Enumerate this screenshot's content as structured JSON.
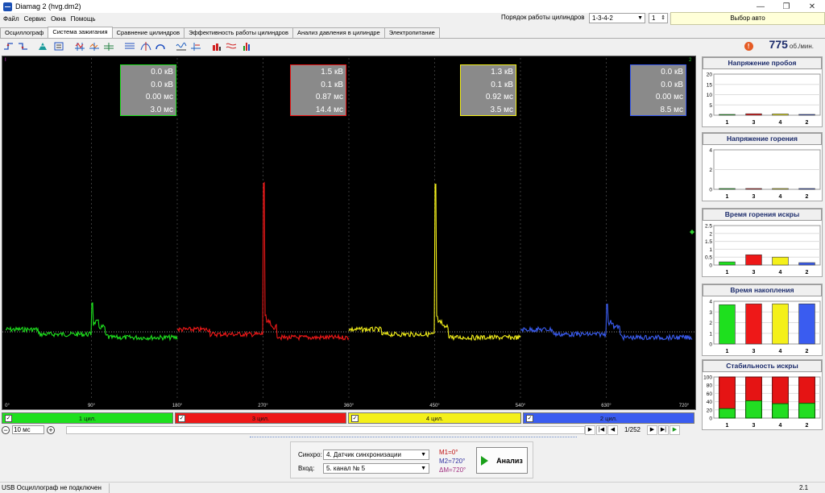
{
  "window": {
    "title": "Diamag 2 (hvg.dm2)",
    "min": "—",
    "restore": "❐",
    "close": "✕"
  },
  "menu": [
    "Файл",
    "Сервис",
    "Окна",
    "Помощь"
  ],
  "header": {
    "cyl_order_label": "Порядок работы цилиндров",
    "cyl_order_value": "1-3-4-2",
    "cyl_num_value": "1",
    "auto_label": "Выбор авто"
  },
  "tabs": [
    "Осциллограф",
    "Система зажигания",
    "Сравнение цилиндров",
    "Эффективность работы цилиндров",
    "Анализ давления в цилиндре",
    "Электропитание"
  ],
  "active_tab": 1,
  "rpm": {
    "warn": "!",
    "value": "775",
    "unit": "об./мин."
  },
  "cylinders": [
    {
      "label": "1 цил.",
      "color": "#1ee01e",
      "check": "✓",
      "box": [
        "0.0 кВ",
        "0.0 кВ",
        "0.00 мс",
        "3.0 мс"
      ]
    },
    {
      "label": "3 цил.",
      "color": "#ee1818",
      "check": "✓",
      "box": [
        "1.5 кВ",
        "0.1 кВ",
        "0.87 мс",
        "14.4 мс"
      ]
    },
    {
      "label": "4 цил.",
      "color": "#f4f01a",
      "check": "✓",
      "box": [
        "1.3 кВ",
        "0.1 кВ",
        "0.92 мс",
        "3.5 мс"
      ]
    },
    {
      "label": "2 цил.",
      "color": "#3a5cf0",
      "check": "✓",
      "box": [
        "0.0 кВ",
        "0.0 кВ",
        "0.00 мс",
        "8.5 мс"
      ]
    }
  ],
  "scope": {
    "x_ticks": [
      "0°",
      "90°",
      "180°",
      "270°",
      "360°",
      "450°",
      "540°",
      "630°",
      "720°"
    ],
    "spikes": [
      0.2,
      1.0,
      0.98,
      0.2
    ],
    "top_marker_left": "I",
    "top_marker_right": "2"
  },
  "controls": {
    "zoom_value": "10 мс",
    "zoom_minus": "−",
    "zoom_plus": "+",
    "nav": [
      "▶",
      "|◀",
      "◀"
    ],
    "page": "1/252",
    "nav2": [
      "▶",
      "▶|",
      "▶"
    ]
  },
  "analysis": {
    "sync_label": "Синхро:",
    "sync_value": "4. Датчик синхронизации",
    "input_label": "Вход:",
    "input_value": "5. канал № 5",
    "m1": "M1=0°",
    "m2": "M2=720°",
    "dm": "ΔM=720°",
    "button": "Анализ"
  },
  "status": {
    "left": "USB Осциллограф не подключен",
    "right": "2.1"
  },
  "side_charts": [
    {
      "title": "Напряжение пробоя",
      "yticks": [
        "20",
        "15",
        "10",
        "5",
        "0"
      ],
      "ymax": 20,
      "categories": [
        "1",
        "3",
        "4",
        "2"
      ],
      "values": [
        0.1,
        0.7,
        0.6,
        0.1
      ]
    },
    {
      "title": "Напряжение горения",
      "yticks": [
        "4",
        "2",
        "0"
      ],
      "ymax": 5,
      "categories": [
        "1",
        "3",
        "4",
        "2"
      ],
      "values": [
        0.05,
        0.05,
        0.05,
        0.05
      ]
    },
    {
      "title": "Время горения искры",
      "yticks": [
        "2.5",
        "2",
        "1.5",
        "1",
        "0.5",
        "0"
      ],
      "ymax": 2.5,
      "categories": [
        "1",
        "3",
        "4",
        "2"
      ],
      "values": [
        0.2,
        0.65,
        0.5,
        0.15
      ]
    },
    {
      "title": "Время накопления",
      "yticks": [
        "4",
        "3",
        "2",
        "1",
        "0"
      ],
      "ymax": 5,
      "categories": [
        "1",
        "3",
        "4",
        "2"
      ],
      "values": [
        4.6,
        4.7,
        4.7,
        4.7
      ]
    },
    {
      "title": "Стабильность искры",
      "yticks": [
        "100",
        "80",
        "60",
        "40",
        "20",
        "0"
      ],
      "ymax": 100,
      "categories": [
        "1",
        "3",
        "4",
        "2"
      ],
      "values": [
        23,
        42,
        35,
        36
      ],
      "stacked_top": 100
    }
  ]
}
